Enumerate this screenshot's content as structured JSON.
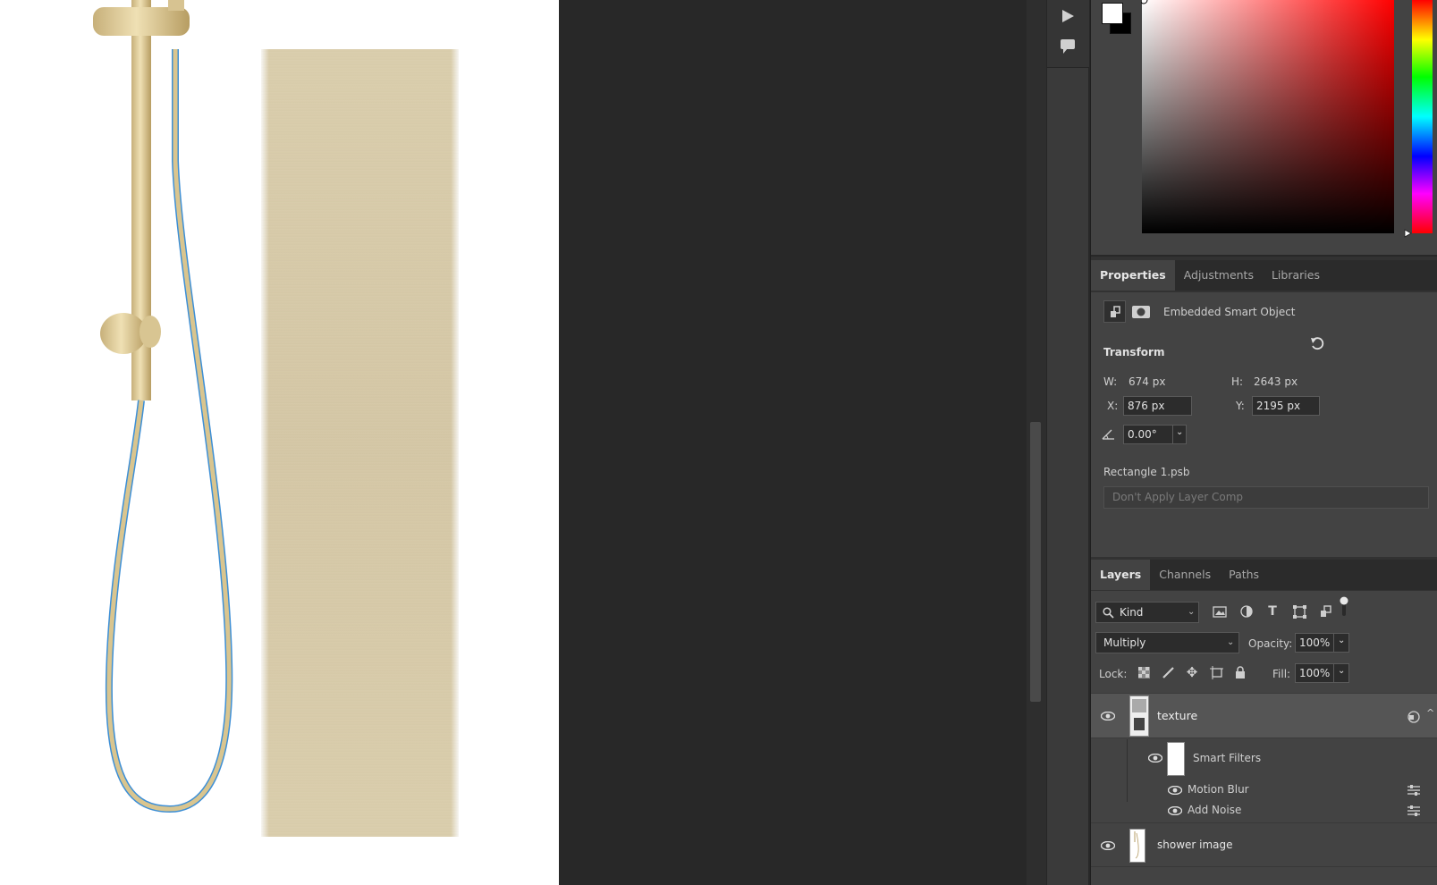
{
  "properties_panel": {
    "tabs": [
      "Properties",
      "Adjustments",
      "Libraries"
    ],
    "object_type": "Embedded Smart Object",
    "transform_label": "Transform",
    "w_label": "W:",
    "w_value": "674 px",
    "h_label": "H:",
    "h_value": "2643 px",
    "x_label": "X:",
    "x_value": "876 px",
    "y_label": "Y:",
    "y_value": "2195 px",
    "angle_value": "0.00°",
    "file_name": "Rectangle 1.psb",
    "layer_comp": "Don't Apply Layer Comp"
  },
  "layers_panel": {
    "tabs": [
      "Layers",
      "Channels",
      "Paths"
    ],
    "filter_kind": "Kind",
    "blend_mode": "Multiply",
    "opacity_label": "Opacity:",
    "opacity_value": "100%",
    "lock_label": "Lock:",
    "fill_label": "Fill:",
    "fill_value": "100%",
    "layers": [
      {
        "name": "texture",
        "selected": true
      },
      {
        "name": "Smart Filters"
      },
      {
        "name": "Motion Blur"
      },
      {
        "name": "Add Noise"
      },
      {
        "name": "shower image"
      }
    ]
  },
  "colors": {
    "panel_bg": "#434343",
    "tabbar_bg": "#2b2b2b",
    "canvas_bg": "#ffffff",
    "workspace_bg": "#282828",
    "brass": "#d2bf8d",
    "selected_layer": "#555555",
    "hose_outline": "#3d8fd6"
  },
  "icons": {
    "play": "play-icon",
    "comment": "comment-icon",
    "reset": "reset-transform-icon",
    "search": "search-icon"
  }
}
